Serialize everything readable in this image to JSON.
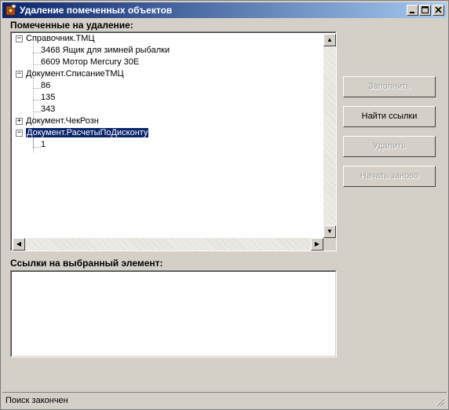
{
  "window": {
    "title": "Удаление помеченных объектов",
    "controls": [
      "minimize",
      "maximize",
      "close"
    ]
  },
  "marked_label": "Помеченные на удаление:",
  "tree": [
    {
      "label": "Справочник.ТМЦ",
      "expanded": true,
      "children": [
        "3468 Ящик для зимней рыбалки",
        "6609 Мотор Mercury 30E"
      ]
    },
    {
      "label": "Документ.СписаниеТМЦ",
      "expanded": true,
      "children": [
        "86",
        "135",
        "343"
      ]
    },
    {
      "label": "Документ.ЧекРозн",
      "expanded": false,
      "children": []
    },
    {
      "label": "Документ.РасчетыПоДисконту",
      "expanded": true,
      "selected": true,
      "children": [
        "1"
      ]
    }
  ],
  "links_label": "Ссылки на выбранный элемент:",
  "buttons": {
    "fill": "Заполнить",
    "find_links": "Найти ссылки",
    "delete": "Удалить",
    "restart": "Начать заново"
  },
  "status": "Поиск закончен",
  "colors": {
    "titlebar_start": "#0a246a",
    "titlebar_end": "#a6caf0",
    "selection": "#0a246a",
    "face": "#d4d0c8"
  }
}
